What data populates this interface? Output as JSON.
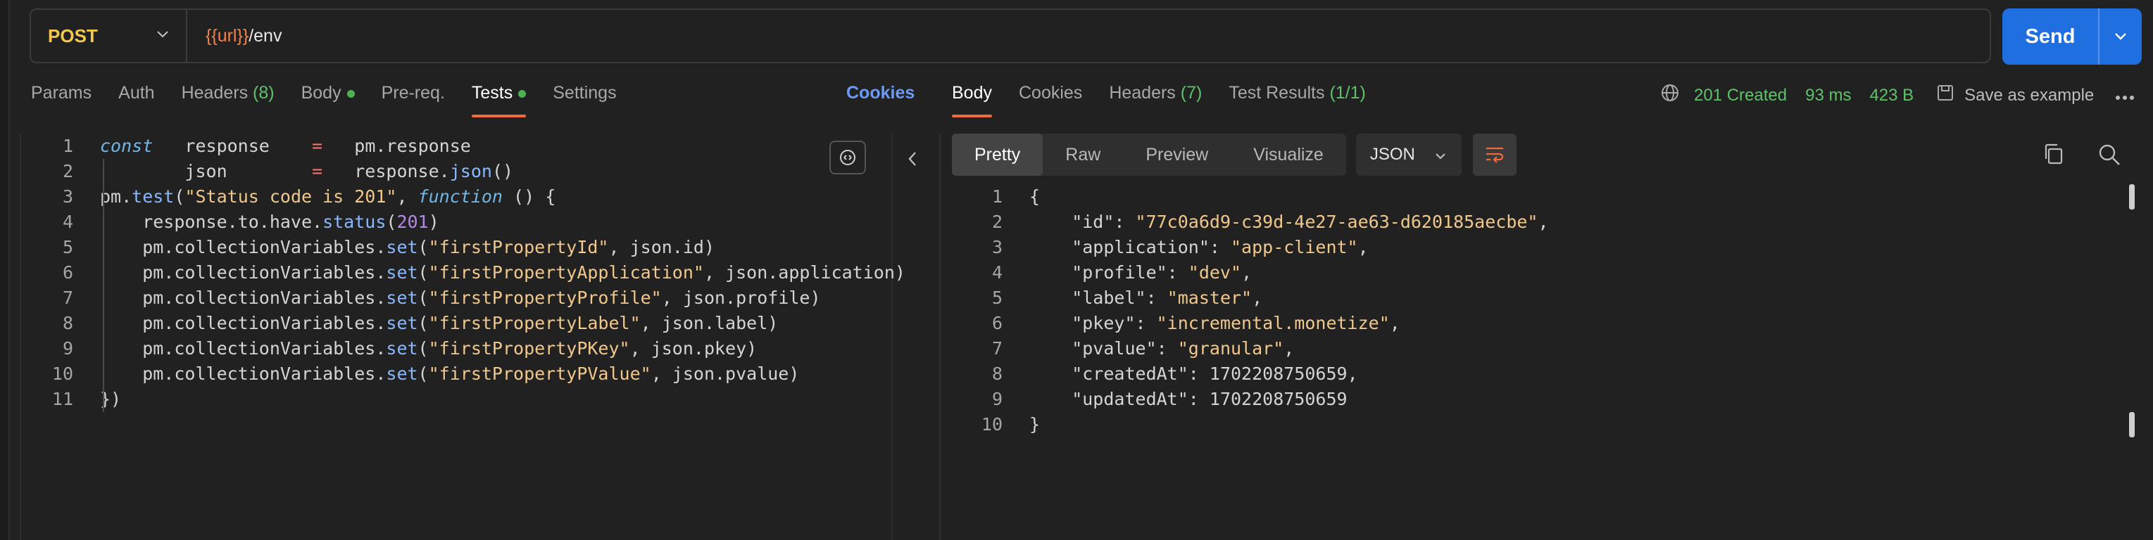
{
  "request": {
    "method": "POST",
    "url_variable": "{{url}}",
    "url_path": "/env",
    "send_label": "Send"
  },
  "request_tabs": [
    {
      "label": "Params"
    },
    {
      "label": "Auth"
    },
    {
      "label": "Headers",
      "count": "(8)"
    },
    {
      "label": "Body"
    },
    {
      "label": "Pre-req."
    },
    {
      "label": "Tests"
    },
    {
      "label": "Settings"
    }
  ],
  "cookies_link": "Cookies",
  "tests_script": {
    "line_numbers": [
      "1",
      "2",
      "3",
      "4",
      "5",
      "6",
      "7",
      "8",
      "9",
      "10",
      "11"
    ],
    "lines": [
      [
        [
          "kw",
          "const"
        ],
        [
          "prop",
          "   response    "
        ],
        [
          "op",
          "="
        ],
        [
          "prop",
          "   pm.response"
        ]
      ],
      [
        [
          "prop",
          "        json        "
        ],
        [
          "op",
          "="
        ],
        [
          "prop",
          "   response."
        ],
        [
          "fn",
          "json"
        ],
        [
          "prop",
          "()"
        ]
      ],
      [
        [
          "prop",
          "pm."
        ],
        [
          "fn",
          "test"
        ],
        [
          "prop",
          "("
        ],
        [
          "str",
          "\"Status code is 201\""
        ],
        [
          "prop",
          ", "
        ],
        [
          "kw",
          "function"
        ],
        [
          "prop",
          " () {"
        ]
      ],
      [
        [
          "prop",
          "    response.to.have."
        ],
        [
          "fn",
          "status"
        ],
        [
          "prop",
          "("
        ],
        [
          "num",
          "201"
        ],
        [
          "prop",
          ")"
        ]
      ],
      [
        [
          "prop",
          "    pm.collectionVariables."
        ],
        [
          "fn",
          "set"
        ],
        [
          "prop",
          "("
        ],
        [
          "str",
          "\"firstPropertyId\""
        ],
        [
          "prop",
          ", json.id)"
        ]
      ],
      [
        [
          "prop",
          "    pm.collectionVariables."
        ],
        [
          "fn",
          "set"
        ],
        [
          "prop",
          "("
        ],
        [
          "str",
          "\"firstPropertyApplication\""
        ],
        [
          "prop",
          ", json.application)"
        ]
      ],
      [
        [
          "prop",
          "    pm.collectionVariables."
        ],
        [
          "fn",
          "set"
        ],
        [
          "prop",
          "("
        ],
        [
          "str",
          "\"firstPropertyProfile\""
        ],
        [
          "prop",
          ", json.profile)"
        ]
      ],
      [
        [
          "prop",
          "    pm.collectionVariables."
        ],
        [
          "fn",
          "set"
        ],
        [
          "prop",
          "("
        ],
        [
          "str",
          "\"firstPropertyLabel\""
        ],
        [
          "prop",
          ", json.label)"
        ]
      ],
      [
        [
          "prop",
          "    pm.collectionVariables."
        ],
        [
          "fn",
          "set"
        ],
        [
          "prop",
          "("
        ],
        [
          "str",
          "\"firstPropertyPKey\""
        ],
        [
          "prop",
          ", json.pkey)"
        ]
      ],
      [
        [
          "prop",
          "    pm.collectionVariables."
        ],
        [
          "fn",
          "set"
        ],
        [
          "prop",
          "("
        ],
        [
          "str",
          "\"firstPropertyPValue\""
        ],
        [
          "prop",
          ", json.pvalue)"
        ]
      ],
      [
        [
          "prop",
          "})"
        ]
      ]
    ]
  },
  "response_tabs": [
    {
      "label": "Body"
    },
    {
      "label": "Cookies"
    },
    {
      "label": "Headers",
      "count": "(7)"
    },
    {
      "label": "Test Results",
      "count": "(1/1)"
    }
  ],
  "response_meta": {
    "status": "201 Created",
    "time": "93 ms",
    "size": "423 B",
    "save_label": "Save as example"
  },
  "view_modes": [
    "Pretty",
    "Raw",
    "Preview",
    "Visualize"
  ],
  "format": "JSON",
  "response_body": {
    "line_numbers": [
      "1",
      "2",
      "3",
      "4",
      "5",
      "6",
      "7",
      "8",
      "9",
      "10"
    ],
    "lines": [
      [
        [
          "json-key",
          "{"
        ]
      ],
      [
        [
          "json-key",
          "    \"id\""
        ],
        [
          "json-key",
          ": "
        ],
        [
          "json-str",
          "\"77c0a6d9-c39d-4e27-ae63-d620185aecbe\""
        ],
        [
          "json-key",
          ","
        ]
      ],
      [
        [
          "json-key",
          "    \"application\""
        ],
        [
          "json-key",
          ": "
        ],
        [
          "json-str",
          "\"app-client\""
        ],
        [
          "json-key",
          ","
        ]
      ],
      [
        [
          "json-key",
          "    \"profile\""
        ],
        [
          "json-key",
          ": "
        ],
        [
          "json-str",
          "\"dev\""
        ],
        [
          "json-key",
          ","
        ]
      ],
      [
        [
          "json-key",
          "    \"label\""
        ],
        [
          "json-key",
          ": "
        ],
        [
          "json-str",
          "\"master\""
        ],
        [
          "json-key",
          ","
        ]
      ],
      [
        [
          "json-key",
          "    \"pkey\""
        ],
        [
          "json-key",
          ": "
        ],
        [
          "json-str",
          "\"incremental.monetize\""
        ],
        [
          "json-key",
          ","
        ]
      ],
      [
        [
          "json-key",
          "    \"pvalue\""
        ],
        [
          "json-key",
          ": "
        ],
        [
          "json-str",
          "\"granular\""
        ],
        [
          "json-key",
          ","
        ]
      ],
      [
        [
          "json-key",
          "    \"createdAt\""
        ],
        [
          "json-key",
          ": "
        ],
        [
          "json-num",
          "1702208750659"
        ],
        [
          "json-key",
          ","
        ]
      ],
      [
        [
          "json-key",
          "    \"updatedAt\""
        ],
        [
          "json-key",
          ": "
        ],
        [
          "json-num",
          "1702208750659"
        ]
      ],
      [
        [
          "json-key",
          "}"
        ]
      ]
    ]
  },
  "colors": {
    "accent": "#f26b3a",
    "send": "#1f6fe0",
    "method": "#f2c94c",
    "status_ok": "#5ec26a"
  }
}
